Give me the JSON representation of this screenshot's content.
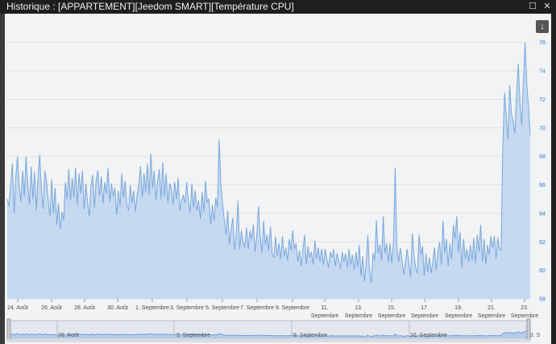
{
  "window": {
    "title": "Historique : [APPARTEMENT][Jeedom SMART][Température CPU]",
    "maximize_glyph": "☐",
    "close_glyph": "✕",
    "export_glyph": "↓",
    "export_icon": "download-icon"
  },
  "chart_data": {
    "type": "area",
    "series": [
      {
        "values": [
          65,
          64.5,
          66,
          67.5,
          64,
          66.5,
          68,
          66,
          64.8,
          67,
          65.2,
          68,
          66,
          64.6,
          67.3,
          65,
          66.9,
          64.2,
          66.5,
          68.1,
          65.7,
          64.3,
          67,
          66.2,
          64.9,
          63.8,
          66.4,
          64,
          65.8,
          63.2,
          64.7,
          62.9,
          64.1,
          63.5,
          66.2,
          65,
          67.1,
          64.9,
          66.5,
          65.1,
          67.2,
          64.6,
          66.8,
          65.4,
          67,
          64.3,
          66.1,
          64.8,
          63.8,
          65.9,
          66.7,
          64.4,
          66.3,
          67,
          65.2,
          66.6,
          64.7,
          66.2,
          65.4,
          67.2,
          64.8,
          66.1,
          65.2,
          65.8,
          63.9,
          65.6,
          64.5,
          66.8,
          65.1,
          66.3,
          64.6,
          64.2,
          66,
          64.7,
          65.6,
          64.1,
          65.3,
          66,
          67.3,
          65.1,
          66.8,
          65.5,
          67.5,
          65.3,
          68.2,
          65.8,
          67,
          64.9,
          66.3,
          67.1,
          65,
          67.6,
          65.2,
          66.8,
          64.7,
          66.1,
          65.8,
          64.6,
          66.2,
          65,
          66.5,
          64.2,
          64.9,
          65.3,
          64.7,
          66.2,
          64.8,
          64.1,
          66.1,
          64.4,
          65.6,
          64.2,
          64.9,
          63.6,
          65.5,
          64.1,
          66.3,
          64.8,
          65,
          63.2,
          64.6,
          63.5,
          65.1,
          64.4,
          69.2,
          66,
          64.7,
          63.5,
          62.5,
          64.2,
          61.8,
          62.9,
          63.7,
          61.4,
          62.5,
          64.9,
          61.5,
          62.8,
          62,
          61.6,
          63,
          61.5,
          62.8,
          62.2,
          63.2,
          61.3,
          62.5,
          64.5,
          62.4,
          61.2,
          63.5,
          61.8,
          62.5,
          61.4,
          63.1,
          61.2,
          60.9,
          62.4,
          61,
          61.9,
          60.8,
          62.4,
          61,
          61.6,
          60.7,
          62.2,
          61.4,
          62.8,
          61.5,
          61.9,
          60.6,
          61.4,
          60.3,
          61.5,
          62.5,
          60.4,
          61.7,
          60.9,
          61.3,
          60.4,
          62.1,
          60.8,
          61.6,
          60.6,
          61.5,
          60.4,
          61.5,
          60.8,
          60.2,
          61.3,
          60.9,
          61.5,
          60.3,
          61.2,
          60.7,
          60.1,
          61.3,
          60.6,
          61.2,
          60.2,
          61.5,
          60.4,
          61.1,
          60,
          61.3,
          60.2,
          61.8,
          59.6,
          61,
          59.2,
          60.5,
          62.5,
          60,
          59.1,
          61.2,
          60.7,
          63.5,
          61.2,
          61.8,
          60.7,
          63.8,
          61.2,
          61.9,
          60.6,
          61.9,
          60.5,
          61.9,
          67.2,
          61.5,
          60.6,
          61.6,
          60.7,
          59.7,
          60.6,
          61.5,
          60.5,
          59.5,
          62.6,
          61,
          60.2,
          59.8,
          62.5,
          61.1,
          61.7,
          59.6,
          61.2,
          59.9,
          60.9,
          59.8,
          60.6,
          61.6,
          60,
          61.3,
          62,
          60.4,
          63.5,
          61.2,
          62.2,
          60.3,
          61.9,
          60.8,
          63.2,
          62.2,
          63.8,
          61.3,
          62.7,
          60.2,
          62.2,
          60.8,
          61.5,
          60.6,
          61.8,
          60.7,
          62.3,
          60.5,
          62.5,
          61.3,
          63.2,
          60.6,
          62.2,
          60.4,
          61.8,
          61.1,
          62.4,
          61.6,
          62.4,
          60.8,
          62.3,
          61.5,
          61.4,
          69,
          72.5,
          70.8,
          69.2,
          73,
          71,
          70.5,
          69.6,
          72.3,
          74.5,
          71.8,
          70.2,
          73.2,
          76,
          73,
          71.5,
          69.5
        ]
      }
    ],
    "xlabels": [
      "24. Août",
      "26. Août",
      "28. Août",
      "30. Août",
      "1. Septembre",
      "3. Septembre",
      "5. Septembre",
      "7. Septembre",
      "9. Septembre",
      "11. Septembre",
      "13. Septembre",
      "15. Septembre",
      "17. Septembre",
      "19. Septembre",
      "21. Septembre",
      "23. Septembre"
    ],
    "y_ticks": [
      "58",
      "60",
      "62",
      "64",
      "66",
      "68",
      "70",
      "72",
      "74",
      "76"
    ],
    "ylim": [
      58,
      77
    ],
    "navigator_labels": [
      "26. Août",
      "2. Septembre",
      "9. Septembre",
      "16. Septembre",
      "23. S"
    ],
    "line_color": "#7aa7dc",
    "fill_color": "#bdd4f0"
  }
}
